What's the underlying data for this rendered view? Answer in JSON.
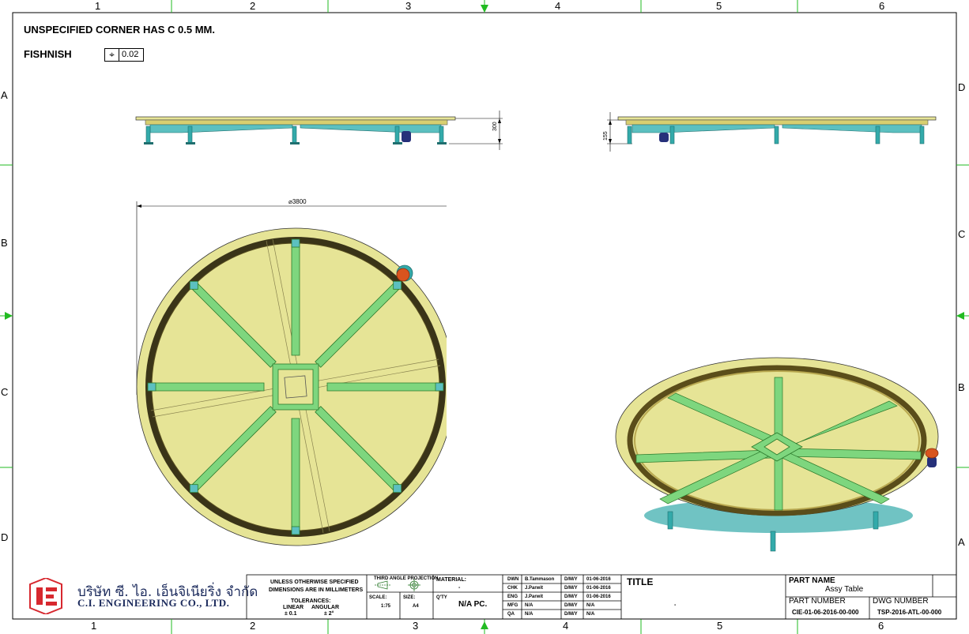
{
  "grid": {
    "columns_top": [
      "1",
      "2",
      "3",
      "4",
      "5",
      "6"
    ],
    "columns_bottom": [
      "1",
      "2",
      "3",
      "4",
      "5",
      "6"
    ],
    "rows_left": [
      "A",
      "B",
      "C",
      "D"
    ],
    "rows_right": [
      "D",
      "C",
      "B",
      "A"
    ]
  },
  "notes": {
    "corner": "UNSPECIFIED CORNER HAS C 0.5 MM.",
    "finish_label": "FISHNISH",
    "flatness_value": "0.02"
  },
  "dimensions": {
    "diameter": "3800",
    "height_front": "300",
    "height_side": "155"
  },
  "company": {
    "name_thai": "บริษัท ซี. ไอ. เอ็นจิเนียริ่ง จำกัด",
    "name_en": "C.I. ENGINEERING CO., LTD."
  },
  "title_block": {
    "unless_1": "UNLESS OTHERWISE SPECIFIED",
    "unless_2": "DIMENSIONS ARE IN MILLIMETERS",
    "tolerances": "TOLERANCES:",
    "linear": "LINEAR",
    "angular": "ANGULAR",
    "linear_val": "± 0.1",
    "angular_val": "± 2°",
    "projection": "THIRD ANGLE PROJECTION",
    "scale_label": "SCALE:",
    "scale_value": "1:75",
    "size_label": "SIZE:",
    "size_value": "A4",
    "material_label": "MATERIAL:",
    "material_value": "-",
    "qty_label": "Q'TY",
    "qty_value": "N/A PC.",
    "approvals": [
      {
        "role": "DWN",
        "name": "B.Tammason",
        "dmy": "D/M/Y",
        "date": "01-06-2016"
      },
      {
        "role": "CHK",
        "name": "J.Parwit",
        "dmy": "D/M/Y",
        "date": "01-06-2016"
      },
      {
        "role": "ENG",
        "name": "J.Parwit",
        "dmy": "D/M/Y",
        "date": "01-06-2016"
      },
      {
        "role": "MFG",
        "name": "N/A",
        "dmy": "D/M/Y",
        "date": "N/A"
      },
      {
        "role": "QA",
        "name": "N/A",
        "dmy": "D/M/Y",
        "date": "N/A"
      }
    ],
    "title_label": "TITLE",
    "title_value": "-",
    "part_name_label": "PART NAME",
    "part_name_value": "Assy Table",
    "part_number_label": "PART NUMBER",
    "part_number_value": "CIE-01-06-2016-00-000",
    "dwg_number_label": "DWG NUMBER",
    "dwg_number_value": "TSP-2016-ATL-00-000"
  },
  "colors": {
    "frame": "#000000",
    "grid_ticks": "#22bb22",
    "table_top": "#e6e496",
    "ring": "#3a3418",
    "beam": "#7ed67e",
    "beam_stroke": "#2c7a2c",
    "leg": "#33aaaa",
    "motor": "#d9541e",
    "motor_base": "#26307a"
  }
}
